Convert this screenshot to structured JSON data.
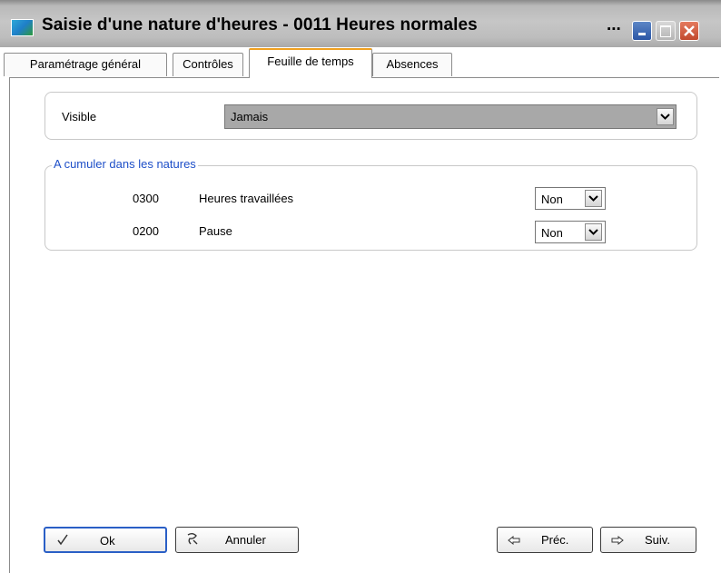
{
  "window": {
    "title": "Saisie d'une nature d'heures - 0011 Heures normales",
    "title_dots": "...",
    "icon": "app-icon",
    "accent": "#f0a020"
  },
  "tabs": [
    {
      "label": "Paramétrage général",
      "active": false
    },
    {
      "label": "Contrôles",
      "active": false
    },
    {
      "label": "Feuille de temps",
      "active": true
    },
    {
      "label": "Absences",
      "active": false
    }
  ],
  "visible": {
    "label": "Visible",
    "value": "Jamais"
  },
  "cumul": {
    "legend": "A cumuler dans les natures",
    "rows": [
      {
        "code": "0300",
        "label": "Heures travaillées",
        "value": "Non"
      },
      {
        "code": "0200",
        "label": "Pause",
        "value": "Non"
      }
    ]
  },
  "buttons": {
    "ok": "Ok",
    "annuler": "Annuler",
    "prec": "Préc.",
    "suiv": "Suiv."
  }
}
